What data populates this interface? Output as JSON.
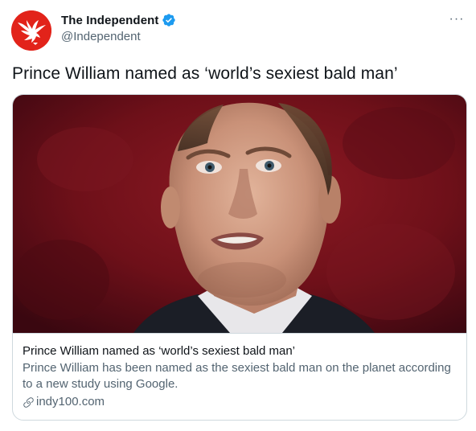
{
  "account": {
    "display_name": "The Independent",
    "handle": "@Independent",
    "avatar_icon": "independent-eagle-logo",
    "verified_icon": "verified-badge-icon",
    "avatar_color": "#e2231a",
    "verified_color": "#1d9bf0"
  },
  "menu": {
    "more_label": "···"
  },
  "tweet": {
    "text": "Prince William named as ‘world’s sexiest bald man’"
  },
  "card": {
    "image_alt": "Prince William portrait",
    "title": "Prince William named as ‘world’s sexiest bald man’",
    "description": "Prince William has been named as the sexiest bald man on the planet according to a new study using Google.",
    "domain": "indy100.com",
    "domain_icon": "link-icon"
  }
}
